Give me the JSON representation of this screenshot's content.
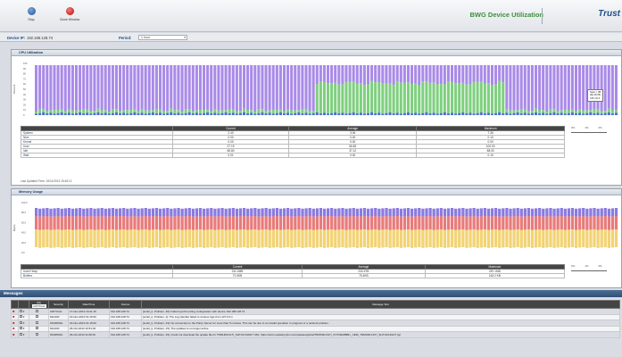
{
  "toolbar": {
    "stop_label": "Stop",
    "close_window_label": "Close Window",
    "app_title": "BWG Device Utilization",
    "logo": "Trust"
  },
  "device_bar": {
    "device_label": "Device IP:",
    "device_value": "192.168.128.74",
    "period_label": "Period:",
    "period_value": "1 hour"
  },
  "cpu_panel": {
    "title": "CPU Utilization",
    "ylabel": "Percent",
    "y_ticks": [
      "100",
      "90",
      "80",
      "70",
      "60",
      "50",
      "40",
      "30",
      "20",
      "10",
      "0"
    ],
    "tooltip": [
      "Span = 3B",
      "Idle 95.5B",
      "CPU 10.3"
    ],
    "headers": [
      "",
      "Current",
      "Average",
      "Maximum"
    ],
    "rows": [
      {
        "name": "System",
        "current": "2.40",
        "average": "3.06",
        "maximum": "7.36"
      },
      {
        "name": "Nice",
        "current": "0.00",
        "average": "0.00",
        "maximum": "0.10"
      },
      {
        "name": "Kernel",
        "current": "0.00",
        "average": "0.00",
        "maximum": "0.00"
      },
      {
        "name": "User",
        "current": "27.19",
        "average": "56.65",
        "maximum": "100.00"
      },
      {
        "name": "Idle",
        "current": "68.80",
        "average": "37.12",
        "maximum": "88.00"
      },
      {
        "name": "Wait",
        "current": "0.01",
        "average": "0.00",
        "maximum": "0.10"
      }
    ],
    "scale_labels": [
      "0%",
      "1%",
      "2%"
    ],
    "last_updated": "Last Updated Time: 15/11/2013 15:45:12"
  },
  "memory_panel": {
    "title": "Memory Usage",
    "ylabel": "Bytes",
    "y_ticks": [
      "100.0",
      "80.0",
      "60.0",
      "40.0",
      "20.0",
      "0.0"
    ],
    "headers": [
      "",
      "Current",
      "Average",
      "Maximum"
    ],
    "rows": [
      {
        "name": "Used Heap",
        "current": "232.0MB",
        "average": "230.5TB",
        "maximum": "287.1MB"
      },
      {
        "name": "Buffers",
        "current": "70.3KB",
        "average": "75.4KB",
        "maximum": "163.2 KB"
      }
    ],
    "scale_labels": [
      "0%",
      "1%",
      "2%"
    ]
  },
  "messages": {
    "title": "Messages",
    "filter_label": "CRITICAL",
    "headers": [
      "",
      "",
      "Ack",
      "Severity",
      "Date/Time",
      "Source",
      "Message Text"
    ],
    "rows": [
      {
        "severity": "CRITICAL",
        "datetime": "17-Nov-2013 16:21:15",
        "source": "192.168.128.74",
        "text": "[scott\\_k, Problem, 30]: Failed synchronizing configuration with device 192.168.128.74"
      },
      {
        "severity": "MAJOR",
        "datetime": "16-Nov-2013 01:15:00",
        "source": "192.168.128.74",
        "text": "[scott\\_k, Problem, 1]: The Log Handler failed to retrieve logs from 127.0.0.1"
      },
      {
        "severity": "WARNING",
        "datetime": "16-Nov-2013 01:15:00",
        "source": "192.168.128.74",
        "text": "[scott\\_k, Problem, 23]: No connection to the Policy Server for more than 5 minutes. This can be due to an invalid operation in progress or a network problem."
      },
      {
        "severity": "MAJOR",
        "datetime": "26-Oct-2013 16:51:40",
        "source": "192.168.128.74",
        "text": "[scott\\_k, Problem, 15]: The updates to no longer active"
      },
      {
        "severity": "WARNING",
        "datetime": "26-Oct-2013 11:08:16",
        "source": "192.168.128.74",
        "text": "[scott\\_k, Problem, 29]: Could not download the update file for TRMURLFILT\\_SHT.01/1402/7 URL: https://ad.tv.updating.ftpr.com/updates/global/TRMURLFILT\\_SYSTEM/BBL\\_VER\\_TRMURLFILT\\_SHT.01/1402/7.tgz"
      }
    ]
  },
  "colors": {
    "cpu_idle": "#a98ae8",
    "cpu_user": "#7fcf7f",
    "cpu_system": "#4a6fd0",
    "mem_top": "#8a7ae0",
    "mem_mid": "#e87b7b",
    "mem_bottom": "#f2d374",
    "accent": "#3f8f3f"
  }
}
